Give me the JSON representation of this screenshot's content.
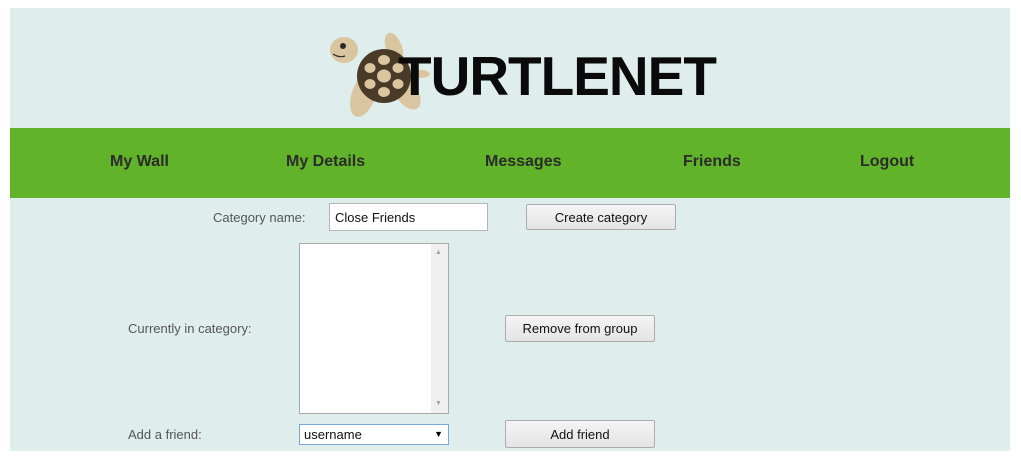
{
  "header": {
    "logo_text": "TURTLENET"
  },
  "nav": {
    "items": [
      {
        "label": "My Wall"
      },
      {
        "label": "My Details"
      },
      {
        "label": "Messages"
      },
      {
        "label": "Friends"
      },
      {
        "label": "Logout"
      }
    ]
  },
  "form": {
    "category_name_label": "Category name:",
    "category_name_value": "Close Friends",
    "create_category_label": "Create category",
    "currently_in_category_label": "Currently in category:",
    "remove_from_group_label": "Remove from group",
    "add_friend_label": "Add a friend:",
    "friend_select_value": "username",
    "add_friend_button_label": "Add friend"
  },
  "colors": {
    "page_background": "#dfeded",
    "nav_background": "#61b32a",
    "shell_brown": "#4a3b28",
    "skin_tan": "#d9c6a0"
  },
  "icons": {
    "logo": "turtle-icon",
    "scroll_up": "scroll-up-arrow-icon",
    "scroll_down": "scroll-down-arrow-icon",
    "select_caret": "chevron-down-icon"
  }
}
